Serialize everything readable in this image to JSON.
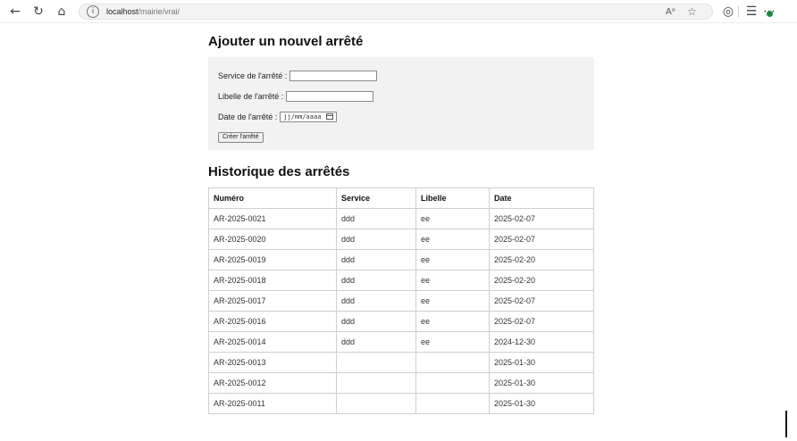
{
  "browser": {
    "url_host": "localhost",
    "url_path": "/mairie/vrai/",
    "read_aloud_label": "Aᵃ"
  },
  "form": {
    "title": "Ajouter un nouvel arrêté",
    "service_label": "Service de l'arrêté :",
    "libelle_label": "Libelle de l'arrêté :",
    "date_label": "Date de l'arrêté :",
    "date_placeholder": "jj/mm/aaaa",
    "submit_label": "Créer l'arrêté"
  },
  "history": {
    "title": "Historique des arrêtés",
    "columns": [
      "Numéro",
      "Service",
      "Libelle",
      "Date"
    ],
    "rows": [
      [
        "AR-2025-0021",
        "ddd",
        "ee",
        "2025-02-07"
      ],
      [
        "AR-2025-0020",
        "ddd",
        "ee",
        "2025-02-07"
      ],
      [
        "AR-2025-0019",
        "ddd",
        "ee",
        "2025-02-20"
      ],
      [
        "AR-2025-0018",
        "ddd",
        "ee",
        "2025-02-20"
      ],
      [
        "AR-2025-0017",
        "ddd",
        "ee",
        "2025-02-07"
      ],
      [
        "AR-2025-0016",
        "ddd",
        "ee",
        "2025-02-07"
      ],
      [
        "AR-2025-0014",
        "ddd",
        "ee",
        "2024-12-30"
      ],
      [
        "AR-2025-0013",
        "",
        "",
        "2025-01-30"
      ],
      [
        "AR-2025-0012",
        "",
        "",
        "2025-01-30"
      ],
      [
        "AR-2025-0011",
        "",
        "",
        "2025-01-30"
      ]
    ]
  },
  "icons": [
    "back-arrow-icon",
    "refresh-icon",
    "home-icon",
    "info-icon",
    "read-aloud-icon",
    "favorite-star-icon",
    "copilot-icon",
    "favorites-list-icon",
    "more-options-icon",
    "calendar-icon"
  ]
}
